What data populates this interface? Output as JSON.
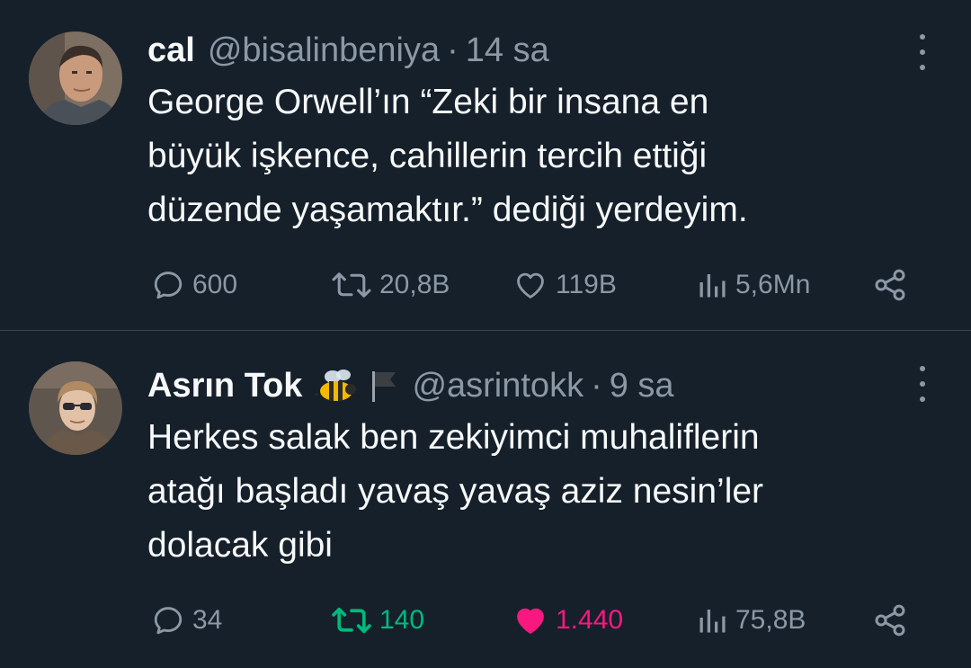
{
  "tweets": [
    {
      "display_name": "cal",
      "handle": "@bisalinbeniya",
      "separator": "·",
      "time": "14 sa",
      "text": "George Orwell’ın “Zeki bir insana en\nbüyük işkence, cahillerin tercih ettiği\ndüzende yaşamaktır.” dediği yerdeyim.",
      "replies": "600",
      "retweets": "20,8B",
      "likes": "119B",
      "views": "5,6Mn",
      "emojis": [],
      "avatar_colors": {
        "bg": "#8a7a6a",
        "skin": "#c99a7c",
        "hair": "#3a2e28",
        "shirt": "#4a5058"
      }
    },
    {
      "display_name": "Asrın Tok",
      "handle": "@asrintokk",
      "separator": "·",
      "time": "9 sa",
      "text": "Herkes salak ben zekiyimci muhaliflerin\natağı başladı yavaş yavaş aziz nesin’ler\ndolacak gibi",
      "replies": "34",
      "retweets": "140",
      "likes": "1.440",
      "views": "75,8B",
      "emojis": [
        "bee-emoji",
        "flag-emoji"
      ],
      "avatar_colors": {
        "bg": "#6e6258",
        "skin": "#e2c2a6",
        "hair": "#b08a62",
        "shirt": "#6a5848"
      }
    }
  ],
  "colors": {
    "background": "#15202b",
    "text": "#f7f9f9",
    "muted": "#8b98a5",
    "retweet_active": "#00ba7c",
    "like_active": "#f91880",
    "divider": "#38444d"
  }
}
